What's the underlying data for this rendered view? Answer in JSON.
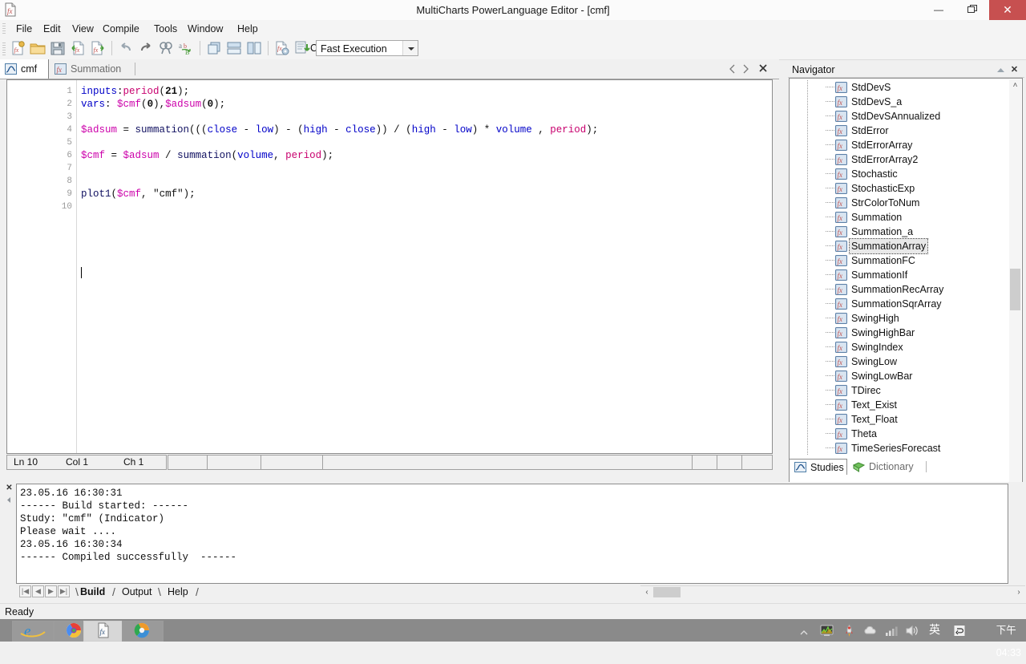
{
  "window": {
    "title": "MultiCharts PowerLanguage Editor - [cmf]",
    "icon": "fx-document-icon",
    "buttons": {
      "minimize": "–",
      "maximize": "❐",
      "close": "✕"
    },
    "close_color": "#c75050"
  },
  "menu": {
    "items": [
      {
        "label": "File"
      },
      {
        "label": "Edit"
      },
      {
        "label": "View"
      },
      {
        "label": "Compile"
      },
      {
        "label": "Tools"
      },
      {
        "label": "Window"
      },
      {
        "label": "Help"
      }
    ]
  },
  "toolbar": {
    "buttons": [
      {
        "name": "new-study-icon"
      },
      {
        "name": "open-folder-icon"
      },
      {
        "name": "save-icon"
      },
      {
        "name": "import-study-icon"
      },
      {
        "name": "export-study-icon"
      },
      {
        "name": "undo-icon"
      },
      {
        "name": "redo-icon"
      },
      {
        "name": "find-icon"
      },
      {
        "name": "replace-icon"
      },
      {
        "name": "cascade-windows-icon"
      },
      {
        "name": "tile-horizontal-icon"
      },
      {
        "name": "tile-vertical-icon"
      },
      {
        "name": "study-properties-icon"
      },
      {
        "name": "compile-icon"
      }
    ],
    "compile_label": "Compile",
    "execution_mode": "Fast Execution"
  },
  "doc_tabs": {
    "tabs": [
      {
        "label": "cmf",
        "icon": "indicator-icon",
        "active": true
      },
      {
        "label": "Summation",
        "icon": "function-icon",
        "active": false
      }
    ],
    "nav_prev": "◁",
    "nav_next": "▷",
    "close": "✕"
  },
  "editor": {
    "line_numbers": [
      "1",
      "2",
      "3",
      "4",
      "5",
      "6",
      "7",
      "8",
      "9",
      "10"
    ],
    "lines": [
      [
        {
          "t": "inputs",
          "c": "k-blue"
        },
        {
          "t": ":",
          "c": "k-plain"
        },
        {
          "t": "period",
          "c": "k-crimson"
        },
        {
          "t": "(",
          "c": "k-plain"
        },
        {
          "t": "21",
          "c": "k-num"
        },
        {
          "t": ");",
          "c": "k-plain"
        }
      ],
      [
        {
          "t": "vars",
          "c": "k-blue"
        },
        {
          "t": ": ",
          "c": "k-plain"
        },
        {
          "t": "$cmf",
          "c": "k-mag"
        },
        {
          "t": "(",
          "c": "k-plain"
        },
        {
          "t": "0",
          "c": "k-num"
        },
        {
          "t": "),",
          "c": "k-plain"
        },
        {
          "t": "$adsum",
          "c": "k-mag"
        },
        {
          "t": "(",
          "c": "k-plain"
        },
        {
          "t": "0",
          "c": "k-num"
        },
        {
          "t": ");",
          "c": "k-plain"
        }
      ],
      [],
      [
        {
          "t": "$adsum",
          "c": "k-mag"
        },
        {
          "t": " = ",
          "c": "k-plain"
        },
        {
          "t": "summation",
          "c": "k-dark"
        },
        {
          "t": "(((",
          "c": "k-plain"
        },
        {
          "t": "close",
          "c": "k-blue"
        },
        {
          "t": " - ",
          "c": "k-plain"
        },
        {
          "t": "low",
          "c": "k-blue"
        },
        {
          "t": ") - (",
          "c": "k-plain"
        },
        {
          "t": "high",
          "c": "k-blue"
        },
        {
          "t": " - ",
          "c": "k-plain"
        },
        {
          "t": "close",
          "c": "k-blue"
        },
        {
          "t": ")) / (",
          "c": "k-plain"
        },
        {
          "t": "high",
          "c": "k-blue"
        },
        {
          "t": " - ",
          "c": "k-plain"
        },
        {
          "t": "low",
          "c": "k-blue"
        },
        {
          "t": ") * ",
          "c": "k-plain"
        },
        {
          "t": "volume",
          "c": "k-blue"
        },
        {
          "t": " , ",
          "c": "k-plain"
        },
        {
          "t": "period",
          "c": "k-crimson"
        },
        {
          "t": ");",
          "c": "k-plain"
        }
      ],
      [],
      [
        {
          "t": "$cmf",
          "c": "k-mag"
        },
        {
          "t": " = ",
          "c": "k-plain"
        },
        {
          "t": "$adsum",
          "c": "k-mag"
        },
        {
          "t": " / ",
          "c": "k-plain"
        },
        {
          "t": "summation",
          "c": "k-dark"
        },
        {
          "t": "(",
          "c": "k-plain"
        },
        {
          "t": "volume",
          "c": "k-blue"
        },
        {
          "t": ", ",
          "c": "k-plain"
        },
        {
          "t": "period",
          "c": "k-crimson"
        },
        {
          "t": ");",
          "c": "k-plain"
        }
      ],
      [],
      [],
      [
        {
          "t": "plot1",
          "c": "k-dark"
        },
        {
          "t": "(",
          "c": "k-plain"
        },
        {
          "t": "$cmf",
          "c": "k-mag"
        },
        {
          "t": ", ",
          "c": "k-plain"
        },
        {
          "t": "\"cmf\"",
          "c": "k-str"
        },
        {
          "t": ");",
          "c": "k-plain"
        }
      ],
      []
    ],
    "status": {
      "line": "Ln 10",
      "column": "Col 1",
      "char": "Ch 1"
    }
  },
  "navigator": {
    "title": "Navigator",
    "pin_icon": "auto-hide-pin-icon",
    "close_icon": "close-icon",
    "scroll_up": "˄",
    "scroll_down": "˅",
    "items": [
      {
        "label": "StdDevS",
        "selected": false
      },
      {
        "label": "StdDevS_a",
        "selected": false
      },
      {
        "label": "StdDevSAnnualized",
        "selected": false
      },
      {
        "label": "StdError",
        "selected": false
      },
      {
        "label": "StdErrorArray",
        "selected": false
      },
      {
        "label": "StdErrorArray2",
        "selected": false
      },
      {
        "label": "Stochastic",
        "selected": false
      },
      {
        "label": "StochasticExp",
        "selected": false
      },
      {
        "label": "StrColorToNum",
        "selected": false
      },
      {
        "label": "Summation",
        "selected": false
      },
      {
        "label": "Summation_a",
        "selected": false
      },
      {
        "label": "SummationArray",
        "selected": true
      },
      {
        "label": "SummationFC",
        "selected": false
      },
      {
        "label": "SummationIf",
        "selected": false
      },
      {
        "label": "SummationRecArray",
        "selected": false
      },
      {
        "label": "SummationSqrArray",
        "selected": false
      },
      {
        "label": "SwingHigh",
        "selected": false
      },
      {
        "label": "SwingHighBar",
        "selected": false
      },
      {
        "label": "SwingIndex",
        "selected": false
      },
      {
        "label": "SwingLow",
        "selected": false
      },
      {
        "label": "SwingLowBar",
        "selected": false
      },
      {
        "label": "TDirec",
        "selected": false
      },
      {
        "label": "Text_Exist",
        "selected": false
      },
      {
        "label": "Text_Float",
        "selected": false
      },
      {
        "label": "Theta",
        "selected": false
      },
      {
        "label": "TimeSeriesForecast",
        "selected": false
      }
    ],
    "tabs": [
      {
        "label": "Studies",
        "icon": "indicator-icon",
        "active": true
      },
      {
        "label": "Dictionary",
        "icon": "dictionary-icon",
        "active": false
      }
    ]
  },
  "output": {
    "close_icon": "close-icon",
    "collapse_icon": "collapse-icon",
    "text": "23.05.16 16:30:31\n------ Build started: ------\nStudy: \"cmf\" (Indicator)\nPlease wait ....\n23.05.16 16:30:34\n------ Compiled successfully  ------",
    "nav_buttons": [
      "⏮",
      "◀",
      "▶",
      "⏭"
    ],
    "tabs": [
      {
        "label": "Build",
        "active": true
      },
      {
        "label": "Output",
        "active": false
      },
      {
        "label": "Help",
        "active": false
      }
    ],
    "hscroll_left": "‹",
    "hscroll_right": "›"
  },
  "statusbar": {
    "text": "Ready"
  },
  "taskbar": {
    "items": [
      {
        "name": "internet-explorer-icon",
        "active": false
      },
      {
        "name": "chrome-colorful-icon",
        "active": false
      },
      {
        "name": "powerlanguage-editor-icon",
        "active": true
      },
      {
        "name": "browser-icon",
        "active": false
      }
    ],
    "tray": {
      "expand": "▲",
      "icons": [
        {
          "name": "resource-monitor-icon"
        },
        {
          "name": "rocket-launcher-icon"
        },
        {
          "name": "cloud-sync-icon"
        },
        {
          "name": "network-signal-icon"
        },
        {
          "name": "volume-icon"
        },
        {
          "name": "ime-language-icon",
          "glyph": "英"
        },
        {
          "name": "ime-switch-icon",
          "glyph": "↺"
        }
      ],
      "clock": "下午 04:33"
    }
  }
}
